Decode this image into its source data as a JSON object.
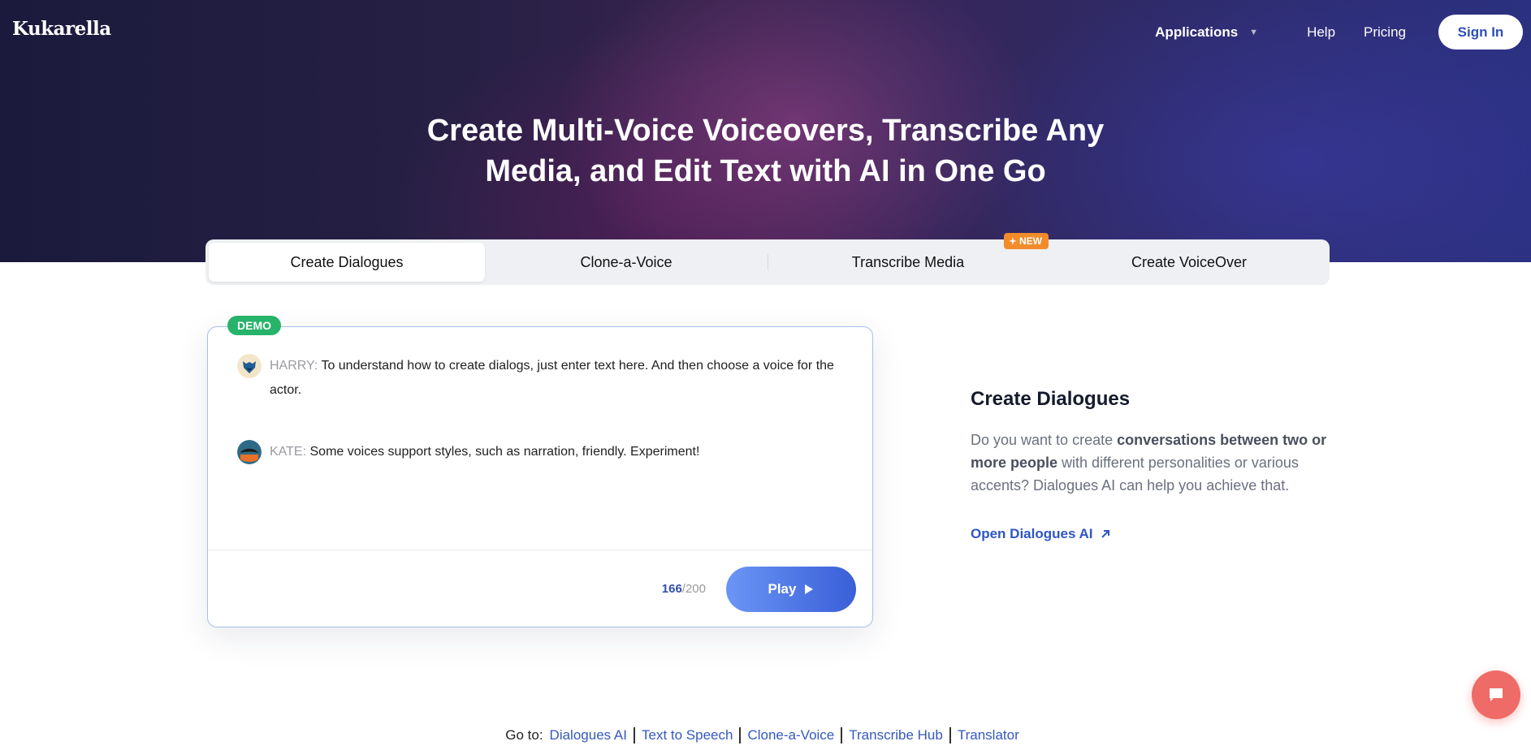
{
  "header": {
    "logo": "Kukarella",
    "nav": {
      "applications": "Applications",
      "help": "Help",
      "pricing": "Pricing",
      "sign_in": "Sign In"
    }
  },
  "hero": {
    "title_line1": "Create Multi-Voice Voiceovers, Transcribe Any",
    "title_line2": "Media, and Edit Text with AI in One Go"
  },
  "tabs": [
    {
      "label": "Create Dialogues",
      "active": true
    },
    {
      "label": "Clone-a-Voice",
      "active": false
    },
    {
      "label": "Transcribe Media",
      "active": false,
      "badge": "NEW"
    },
    {
      "label": "Create VoiceOver",
      "active": false
    }
  ],
  "demo": {
    "badge": "DEMO",
    "lines": [
      {
        "speaker": "HARRY:",
        "text": "To understand how to create dialogs, just enter text here. And then choose a voice for the actor.",
        "avatar_icon": "fox-avatar-icon"
      },
      {
        "speaker": "KATE:",
        "text": "Some voices support styles, such as narration, friendly. Experiment!",
        "avatar_icon": "tree-avatar-icon"
      }
    ],
    "counter_current": "166",
    "counter_max": "/200",
    "play_label": "Play"
  },
  "side": {
    "title": "Create Dialogues",
    "desc_pre": "Do you want to create ",
    "desc_bold": "conversations between two or more people",
    "desc_post": " with different personalities or various accents? Dialogues AI can help you achieve that.",
    "link": "Open Dialogues AI"
  },
  "footer": {
    "go_to": "Go to:",
    "links": [
      "Dialogues AI",
      "Text to Speech",
      "Clone-a-Voice",
      "Transcribe Hub",
      "Translator"
    ]
  },
  "colors": {
    "accent": "#3a5fd8",
    "demo_badge": "#27b36a",
    "new_badge": "#f08c2a",
    "chat": "#ef6b67"
  }
}
